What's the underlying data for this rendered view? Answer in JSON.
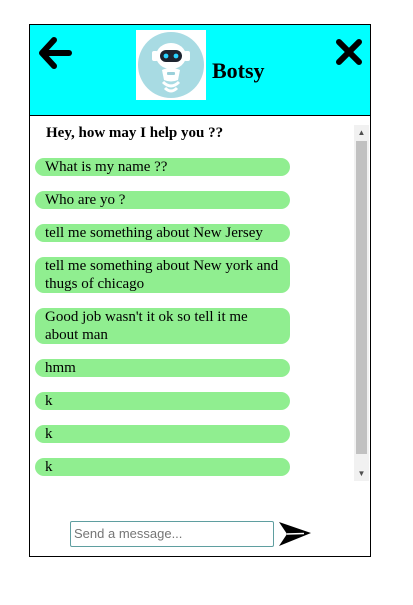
{
  "header": {
    "bot_name": "Botsy",
    "back_icon": "arrow-left-icon",
    "close_icon": "close-icon",
    "avatar_icon": "robot-avatar",
    "background_color": "#00ffff"
  },
  "chat": {
    "greeting": "Hey, how may I help you ??",
    "bubble_color": "#90ee90",
    "messages": [
      "What is my name ??",
      "Who are yo ?",
      "tell me something about New Jersey",
      "tell me something about New york and thugs of chicago",
      "Good job wasn't it ok so tell it me about man",
      "hmm",
      "k",
      "k",
      "k"
    ]
  },
  "composer": {
    "placeholder": "Send a message...",
    "value": "",
    "send_icon": "send-icon"
  }
}
